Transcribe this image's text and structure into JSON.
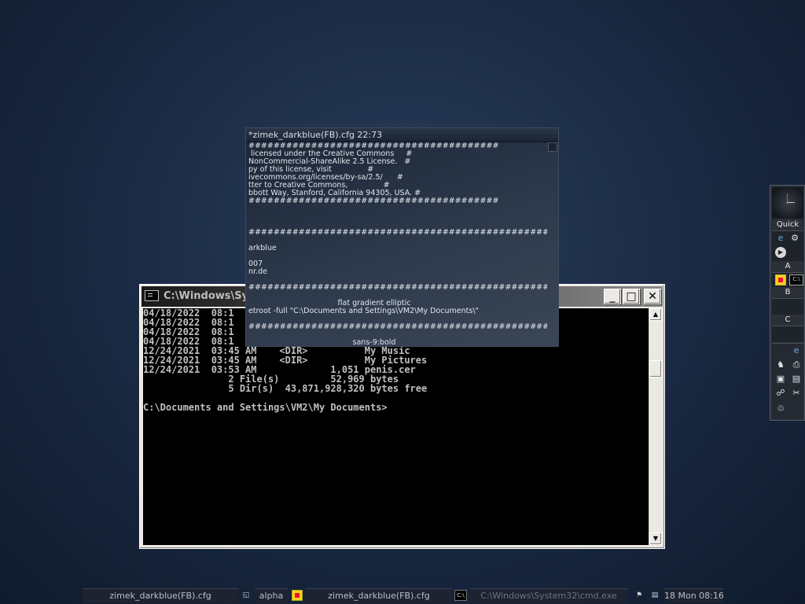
{
  "cmd_window": {
    "title": "C:\\Windows\\System32\\cmd.exe",
    "minimize_glyph": "_",
    "maximize_glyph": "□",
    "close_glyph": "✕",
    "lines": [
      "04/18/2022  08:1",
      "04/18/2022  08:1",
      "04/18/2022  08:1",
      "04/18/2022  08:1",
      "12/24/2021  03:45 AM    <DIR>          My Music",
      "12/24/2021  03:45 AM    <DIR>          My Pictures",
      "12/24/2021  03:53 AM             1,051 penis.cer",
      "               2 File(s)         52,969 bytes",
      "               5 Dir(s)  43,871,928,320 bytes free",
      "",
      "C:\\Documents and Settings\\VM2\\My Documents>"
    ]
  },
  "editor_window": {
    "title": "*zimek_darkblue(FB).cfg  22:73",
    "lines": [
      {
        "text": "########################################",
        "hl": true
      },
      {
        "text": " licensed under the Creative Commons     #",
        "hl": true
      },
      {
        "text": "NonCommercial-ShareAlike 2.5 License.   #",
        "hl": true
      },
      {
        "text": "py of this license, visit               #",
        "hl": true
      },
      {
        "text": "ivecommons.org/licenses/by-sa/2.5/      #",
        "hl": true
      },
      {
        "text": "tter to Creative Commons,               #",
        "hl": true
      },
      {
        "text": "bbott Way, Stanford, California 94305, USA. #",
        "hl": true
      },
      {
        "text": "########################################",
        "hl": true
      },
      {
        "text": "",
        "hl": false
      },
      {
        "text": "",
        "hl": false
      },
      {
        "text": "",
        "hl": false
      },
      {
        "text": "############################################################",
        "hl": false
      },
      {
        "text": "",
        "hl": false
      },
      {
        "text": "arkblue",
        "hl": false
      },
      {
        "text": "",
        "hl": false
      },
      {
        "text": "007",
        "hl": false
      },
      {
        "text": "nr.de",
        "hl": false
      },
      {
        "text": "",
        "hl": false
      },
      {
        "text": "################################################ BACKGROUND #####",
        "hl": false
      },
      {
        "text": "",
        "hl": false
      },
      {
        "text": "flat gradient elliptic",
        "hl": false,
        "center": true
      },
      {
        "text": "etroot -full \"C:\\Documents and Settings\\VM2\\My Documents\\\"",
        "hl": false
      },
      {
        "text": "",
        "hl": false
      },
      {
        "text": "################################################### FONTS ##########",
        "hl": false
      },
      {
        "text": "",
        "hl": false
      },
      {
        "text": "sans-9:bold",
        "hl": false,
        "center": true
      }
    ]
  },
  "dock": {
    "quick_label": "Quick",
    "section_a": "A",
    "section_b": "B",
    "section_c": "C",
    "icons": [
      "internet-explorer-icon",
      "settings-icon",
      "media-player-icon",
      "app-icon",
      "terminal-icon",
      "internet-explorer-icon",
      "games-icon",
      "printer-icon",
      "recycle-bin-icon",
      "network-icon"
    ]
  },
  "taskbar": {
    "item1": "zimek_darkblue(FB).cfg",
    "workspace": "alpha",
    "item2": "zimek_darkblue(FB).cfg",
    "item3": "C:\\Windows\\System32\\cmd.exe",
    "clock": "18 Mon 08:16"
  }
}
